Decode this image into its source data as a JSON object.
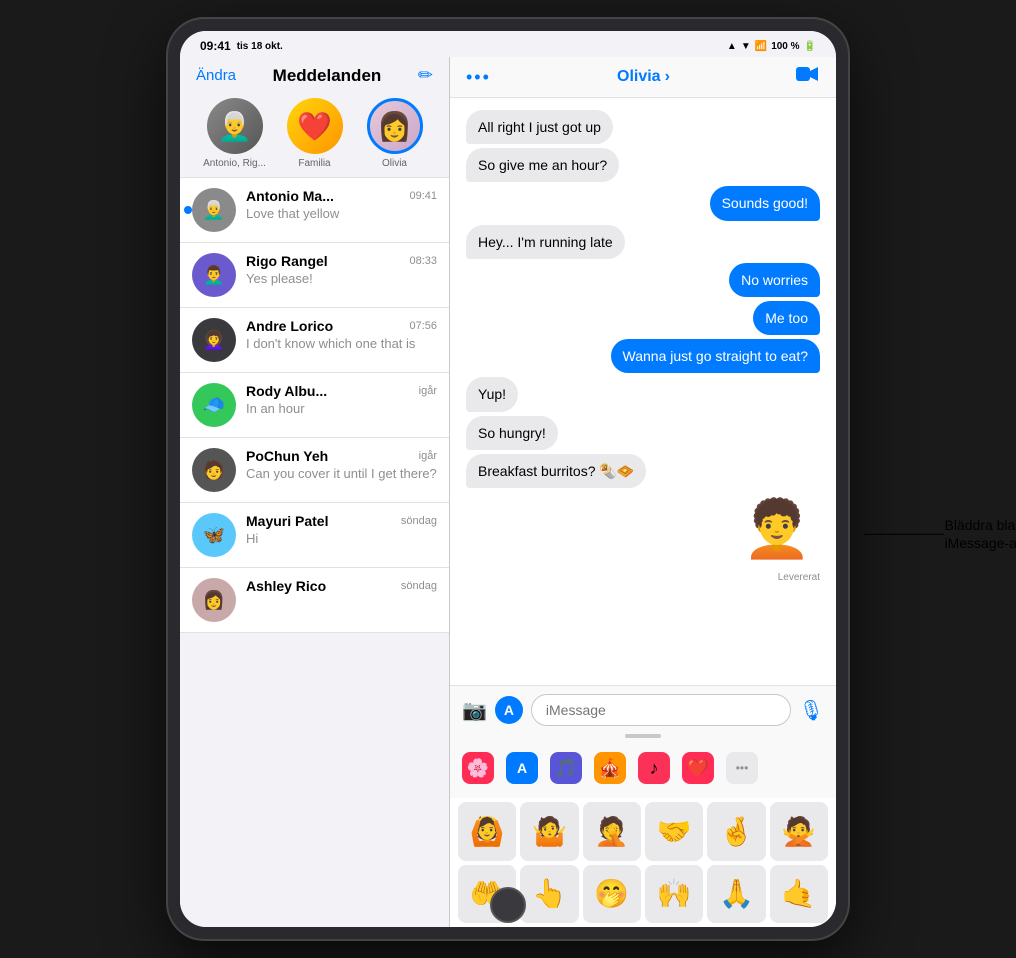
{
  "statusBar": {
    "time": "09:41",
    "date": "tis 18 okt.",
    "signal": "▲",
    "wifi": "WiFi",
    "battery": "100 %"
  },
  "sidebar": {
    "editLabel": "Ändra",
    "titleLabel": "Meddelanden",
    "composeIcon": "✏️",
    "pinnedContacts": [
      {
        "id": "antonio",
        "name": "Antonio, Rig...",
        "emoji": "👨‍🦳"
      },
      {
        "id": "familia",
        "name": "Familia",
        "emoji": "❤️"
      },
      {
        "id": "olivia",
        "name": "Olivia",
        "emoji": "👩"
      }
    ],
    "conversations": [
      {
        "id": "antonio-ma",
        "name": "Antonio Ma...",
        "time": "09:41",
        "preview": "Love that yellow",
        "unread": true,
        "emoji": "👨‍🦳"
      },
      {
        "id": "rigo-rangel",
        "name": "Rigo Rangel",
        "time": "08:33",
        "preview": "Yes please!",
        "unread": false,
        "emoji": "👨‍🦱"
      },
      {
        "id": "andre-lorico",
        "name": "Andre Lorico",
        "time": "07:56",
        "preview": "I don't know which one that is",
        "unread": false,
        "emoji": "👩‍🦱"
      },
      {
        "id": "rody-albu",
        "name": "Rody Albu...",
        "time": "igår",
        "preview": "In an hour",
        "unread": false,
        "emoji": "👨‍🟢"
      },
      {
        "id": "pochun-yeh",
        "name": "PoChun Yeh",
        "time": "igår",
        "preview": "Can you cover it until I get there?",
        "unread": false,
        "emoji": "🧑"
      },
      {
        "id": "mayuri-patel",
        "name": "Mayuri Patel",
        "time": "söndag",
        "preview": "Hi",
        "unread": false,
        "emoji": "🦋"
      },
      {
        "id": "ashley-rico",
        "name": "Ashley Rico",
        "time": "söndag",
        "preview": "",
        "unread": false,
        "emoji": "👩"
      }
    ]
  },
  "chat": {
    "contactName": "Olivia",
    "chevron": "›",
    "videoIcon": "📹",
    "dotsLabel": "•••",
    "deliveredLabel": "Levererat",
    "messages": [
      {
        "id": 1,
        "text": "All right I just got up",
        "type": "received"
      },
      {
        "id": 2,
        "text": "So give me an hour?",
        "type": "received"
      },
      {
        "id": 3,
        "text": "Sounds good!",
        "type": "sent"
      },
      {
        "id": 4,
        "text": "Hey... I'm running late",
        "type": "received"
      },
      {
        "id": 5,
        "text": "No worries",
        "type": "sent"
      },
      {
        "id": 6,
        "text": "Me too",
        "type": "sent"
      },
      {
        "id": 7,
        "text": "Wanna just go straight to eat?",
        "type": "sent"
      },
      {
        "id": 8,
        "text": "Yup!",
        "type": "received"
      },
      {
        "id": 9,
        "text": "So hungry!",
        "type": "received"
      },
      {
        "id": 10,
        "text": "Breakfast burritos? 🌯🧇",
        "type": "received"
      }
    ],
    "inputPlaceholder": "iMessage",
    "appTray": [
      {
        "id": "photos",
        "icon": "🌸",
        "bg": "#ff2d55"
      },
      {
        "id": "appstore",
        "icon": "🅐",
        "bg": "#007aff"
      },
      {
        "id": "audio",
        "icon": "🎵",
        "bg": "#5856d6"
      },
      {
        "id": "memoji-stickers",
        "icon": "🧇",
        "bg": "#ff9500"
      },
      {
        "id": "music",
        "icon": "♪",
        "bg": "#fc3158"
      },
      {
        "id": "heartbeat",
        "icon": "❤️",
        "bg": "#fc3158"
      },
      {
        "id": "more",
        "icon": "•••",
        "bg": "#8e8e93"
      }
    ]
  },
  "annotation": {
    "text": "Bläddra bland\niMessage-appar."
  },
  "memojiGrid": [
    "🙆",
    "🤷",
    "🤦",
    "🤝",
    "🤞",
    "🙅",
    "🤲",
    "👆",
    "🤭",
    "🙌",
    "🙏",
    "🤙"
  ]
}
